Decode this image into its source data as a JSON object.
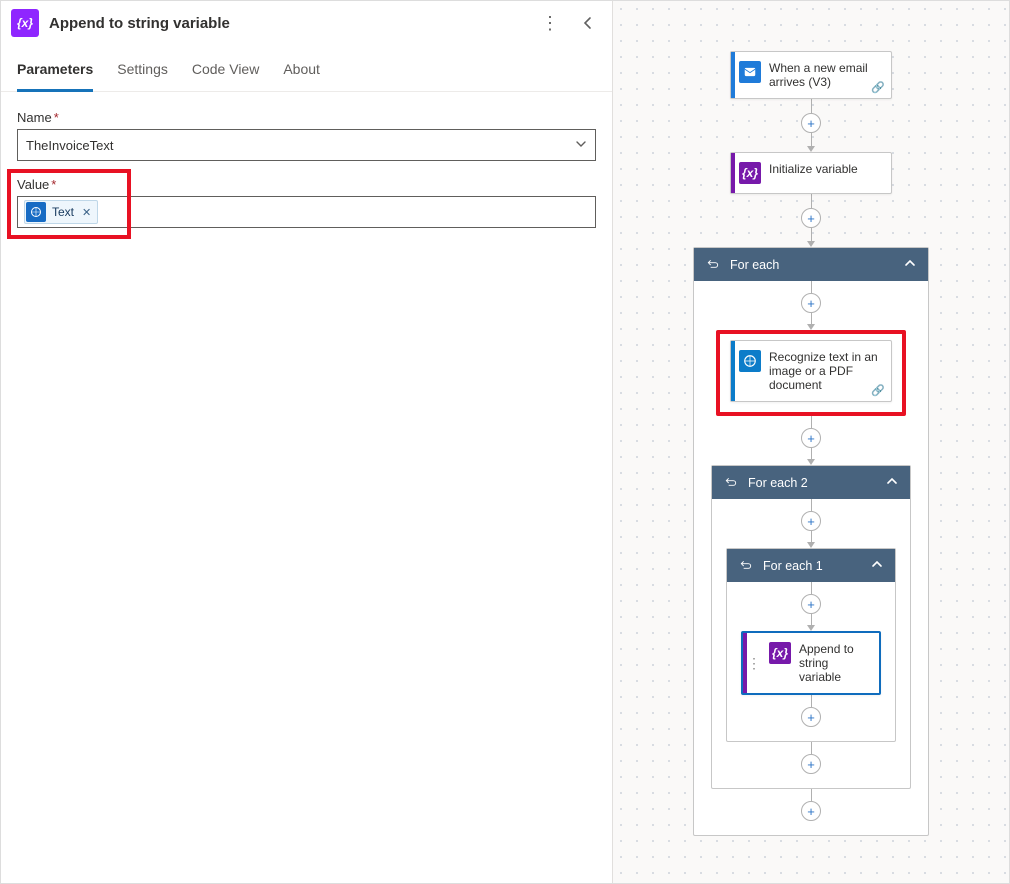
{
  "header": {
    "title": "Append to string variable"
  },
  "tabs": [
    {
      "id": "parameters",
      "label": "Parameters",
      "active": true
    },
    {
      "id": "settings",
      "label": "Settings",
      "active": false
    },
    {
      "id": "codeview",
      "label": "Code View",
      "active": false
    },
    {
      "id": "about",
      "label": "About",
      "active": false
    }
  ],
  "fields": {
    "name": {
      "label": "Name",
      "required": true,
      "value": "TheInvoiceText"
    },
    "value": {
      "label": "Value",
      "required": true,
      "token": {
        "label": "Text",
        "icon": "cv"
      }
    }
  },
  "flow": {
    "nodes": {
      "email": {
        "label": "When a new email arrives (V3)",
        "color": "#1f7bd9",
        "icon": "outlook",
        "hasLink": true
      },
      "initVar": {
        "label": "Initialize variable",
        "color": "#7719aa",
        "icon": "var"
      },
      "forEach": {
        "label": "For each"
      },
      "recognize": {
        "label": "Recognize text in an image or a PDF document",
        "color": "#0c7cc9",
        "icon": "cv",
        "hasLink": true
      },
      "forEach2": {
        "label": "For each 2"
      },
      "forEach1": {
        "label": "For each 1"
      },
      "append": {
        "label": "Append to string variable",
        "color": "#7719aa",
        "icon": "var",
        "selected": true
      }
    }
  }
}
